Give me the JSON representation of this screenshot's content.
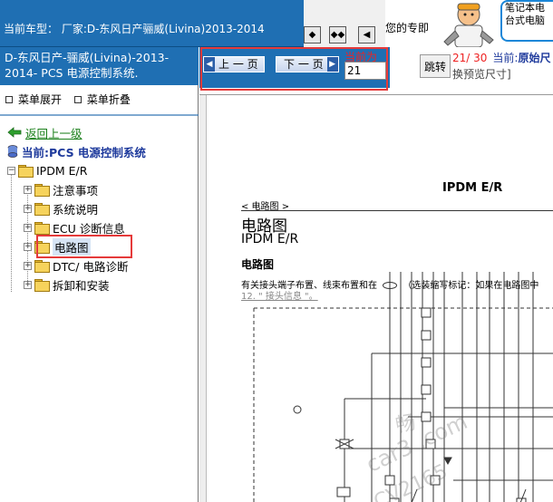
{
  "top": {
    "vehicle_title": "当前车型： 厂家:D-东风日产骊威(Livina)2013-2014",
    "right_text": "您的专即",
    "promo_line1": "笔记本电",
    "promo_line2": "台式电脑"
  },
  "left": {
    "system_title": "D-东风日产-骊威(Livina)-2013-2014- PCS 电源控制系统.",
    "expand_all": "菜单展开",
    "collapse_all": "菜单折叠",
    "back_link": "返回上一级",
    "current_system": "当前:PCS 电源控制系统",
    "tree_root": "IPDM E/R",
    "tree_items": [
      {
        "label": "注意事项"
      },
      {
        "label": "系统说明"
      },
      {
        "label": "ECU 诊断信息"
      },
      {
        "label": "电路图"
      },
      {
        "label": "DTC/ 电路诊断"
      },
      {
        "label": "拆卸和安装"
      }
    ]
  },
  "toolbar": {
    "prev_label": "上 一 页",
    "next_label": "下 一 页",
    "current_label": "当前为",
    "current_value": "21",
    "jump_label": "跳转",
    "page_current": "21",
    "page_total": "/ 30",
    "size_prefix": "当前:",
    "size_value": "原始尺",
    "size_hint": "换预览尺寸]"
  },
  "document": {
    "header_right": "IPDM E/R",
    "breadcrumb": "< 电路图 >",
    "title": "电路图",
    "subtitle": "IPDM E/R",
    "section": "电路图",
    "body_line1": "有关接头端子布置、线束布置和在",
    "body_line1b": "（选装缩写标记：如果在电路图中",
    "body_line2": "12. \" 接头信息 \"。",
    "watermark_1": "畅",
    "watermark_2": "car3      .com",
    "watermark_3": "CV2165"
  },
  "colors": {
    "header_blue": "#1f6fb3",
    "highlight_red": "#e53a3a",
    "link_green": "#1a7f1a"
  }
}
